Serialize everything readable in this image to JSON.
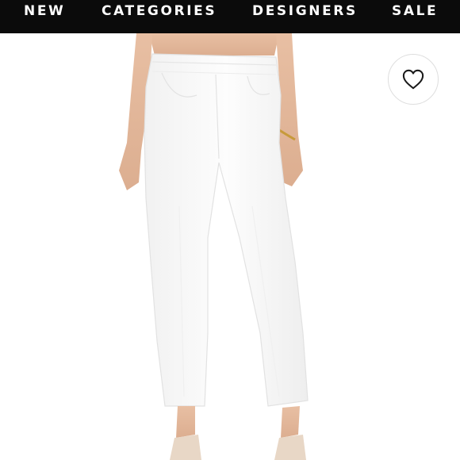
{
  "nav": {
    "items": [
      {
        "label": "NEW"
      },
      {
        "label": "CATEGORIES"
      },
      {
        "label": "DESIGNERS"
      },
      {
        "label": "SALE"
      }
    ]
  },
  "colors": {
    "nav_background": "#0b0b0b",
    "nav_text": "#ffffff",
    "page_background": "#ffffff",
    "garment": "#fbfbfb"
  },
  "product": {
    "image_icon": "product-photo-white-cropped-jeans",
    "favorite_icon": "heart-outline-icon"
  }
}
